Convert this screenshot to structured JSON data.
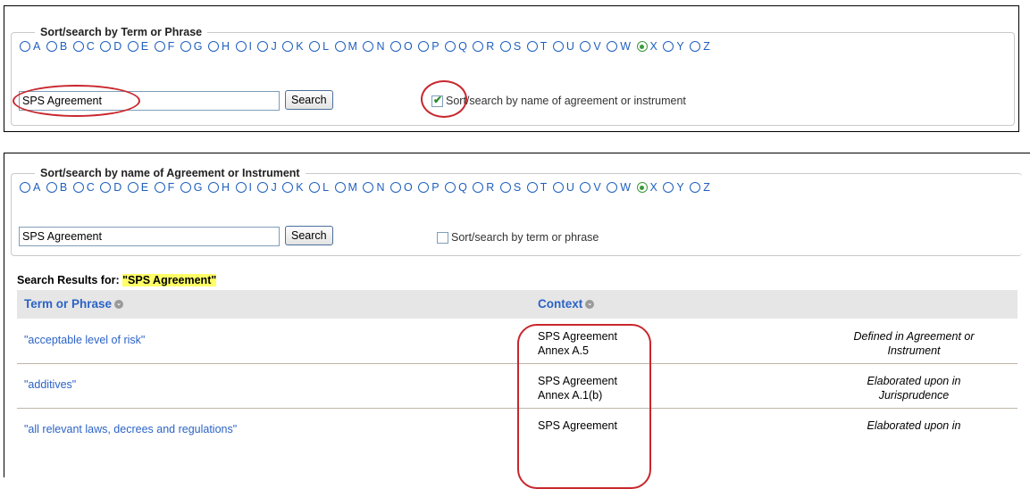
{
  "letters": [
    "A",
    "B",
    "C",
    "D",
    "E",
    "F",
    "G",
    "H",
    "I",
    "J",
    "K",
    "L",
    "M",
    "N",
    "O",
    "P",
    "Q",
    "R",
    "S",
    "T",
    "U",
    "V",
    "W",
    "X",
    "Y",
    "Z"
  ],
  "selected_letter": "X",
  "panel_top": {
    "legend": "Sort/search by Term or Phrase",
    "search_value": "SPS Agreement",
    "search_button": "Search",
    "checkbox_label": "Sort/search by name of agreement or instrument",
    "checkbox_checked": true
  },
  "panel_bottom": {
    "legend": "Sort/search by name of Agreement or Instrument",
    "search_value": "SPS Agreement",
    "search_button": "Search",
    "checkbox_label": "Sort/search by term or phrase",
    "checkbox_checked": false
  },
  "results": {
    "title_prefix": "Search Results for:",
    "query": "\"SPS Agreement\"",
    "col_term": "Term or Phrase",
    "col_context": "Context",
    "rows": [
      {
        "term": "\"acceptable level of risk\"",
        "ctx1": "SPS Agreement",
        "ctx2": "Annex A.5",
        "note1": "Defined in Agreement or",
        "note2": "Instrument"
      },
      {
        "term": "\"additives\"",
        "ctx1": "SPS Agreement",
        "ctx2": "Annex A.1(b)",
        "note1": "Elaborated upon in",
        "note2": "Jurisprudence"
      },
      {
        "term": "\"all relevant laws, decrees and regulations\"",
        "ctx1": "SPS Agreement",
        "ctx2": "",
        "note1": "Elaborated upon in",
        "note2": ""
      }
    ]
  },
  "colors": {
    "link": "#2b63c7",
    "annotation": "#c8272d",
    "highlight": "#ffff66"
  }
}
